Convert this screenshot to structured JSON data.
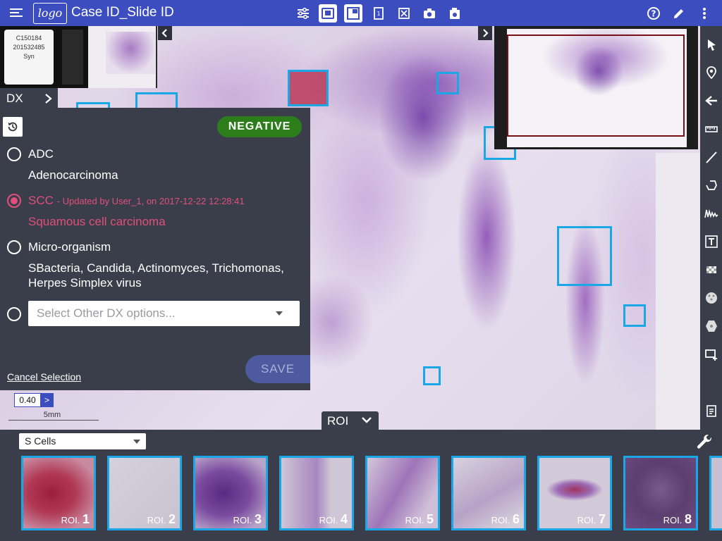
{
  "header": {
    "logo_text": "logo",
    "title": "Case ID_Slide ID",
    "icons": [
      "sliders-icon",
      "slide-info-icon",
      "viewer-layout-icon",
      "label-icon",
      "fullscreen-icon",
      "camera-icon",
      "gallery-camera-icon"
    ],
    "right_icons": [
      "help-icon",
      "edit-pencil-icon",
      "more-vert-icon"
    ]
  },
  "slide_label": {
    "line1": "C150184",
    "line2": "201532485",
    "line3": "Syn"
  },
  "dx_tab": {
    "label": "DX"
  },
  "dx_panel": {
    "status_badge": "NEGATIVE",
    "options": [
      {
        "code": "ADC",
        "description": "Adenocarcinoma",
        "selected": false
      },
      {
        "code": "SCC",
        "updated_note": "- Updated by User_1, on 2017-12-22 12:28:41",
        "description": "Squamous cell carcinoma",
        "selected": true
      },
      {
        "code": "Micro-organism",
        "description_line1": "SBacteria, Candida, Actinomyces, Trichomonas,",
        "description_line2": "Herpes Simplex virus",
        "selected": false
      }
    ],
    "other_placeholder": "Select Other DX options...",
    "cancel_label": "Cancel Selection",
    "save_label": "SAVE"
  },
  "zoom": {
    "value": "0.40",
    "button": ">"
  },
  "scale_bar": {
    "label": "5mm"
  },
  "roi_toggle": {
    "label": "ROI"
  },
  "cell_filter": {
    "selected": "S Cells"
  },
  "roi_thumbnails": [
    {
      "prefix": "ROI.",
      "number": "1"
    },
    {
      "prefix": "ROI.",
      "number": "2"
    },
    {
      "prefix": "ROI.",
      "number": "3"
    },
    {
      "prefix": "ROI.",
      "number": "4"
    },
    {
      "prefix": "ROI.",
      "number": "5"
    },
    {
      "prefix": "ROI.",
      "number": "6"
    },
    {
      "prefix": "ROI.",
      "number": "7"
    },
    {
      "prefix": "ROI.",
      "number": "8"
    }
  ],
  "colors": {
    "header": "#3b4dbf",
    "panel": "#3a3d4a",
    "roi_border": "#19a7e6",
    "selected_pink": "#e0507a",
    "negative_badge": "#2e7d1b"
  }
}
